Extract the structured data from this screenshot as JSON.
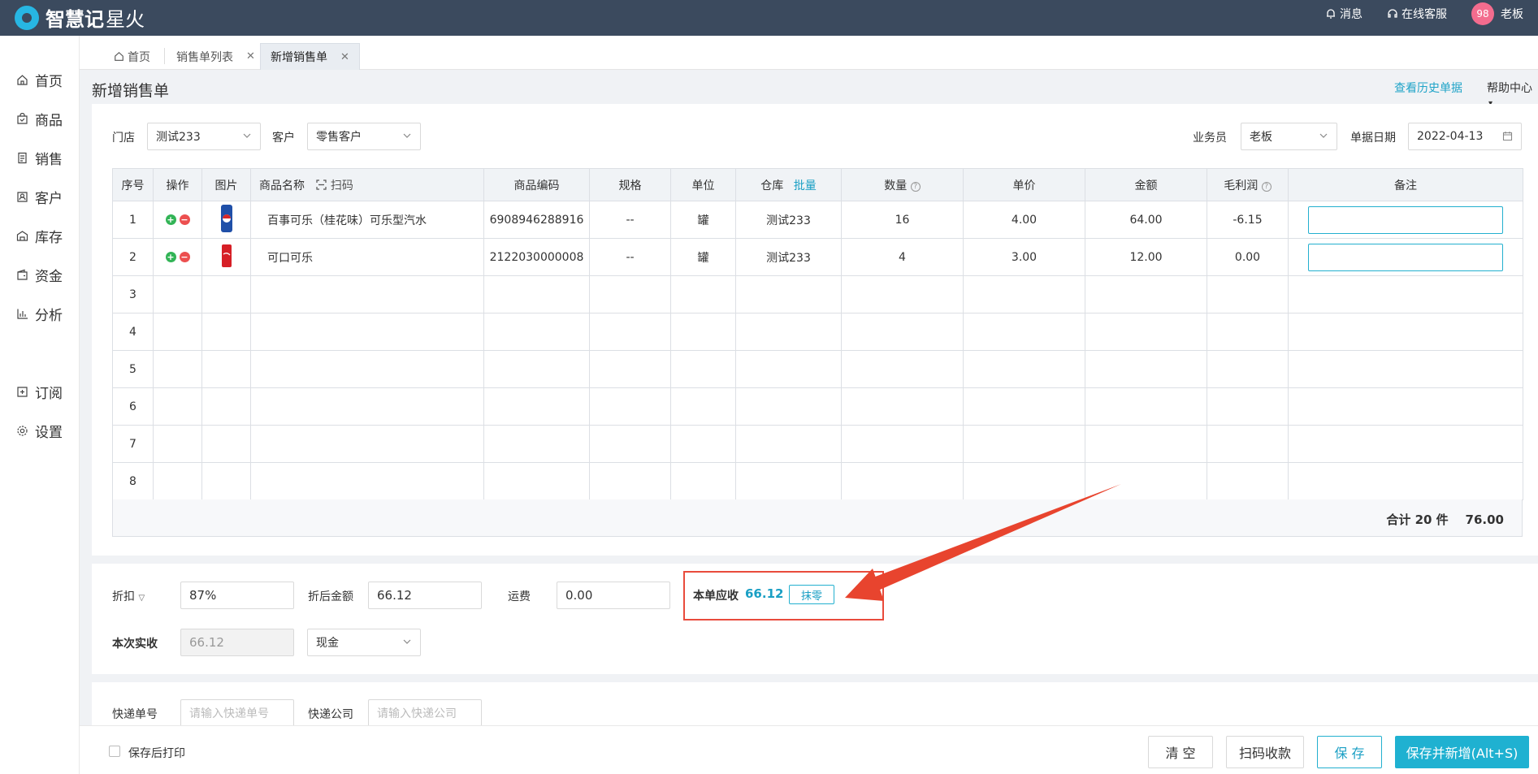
{
  "topbar": {
    "brand": "智慧记",
    "brand_sub": "星火",
    "messages_label": "消息",
    "support_label": "在线客服",
    "avatar_text": "98",
    "user_name": "老板"
  },
  "sidebar": {
    "items": [
      {
        "label": "首页",
        "icon": "home-icon"
      },
      {
        "label": "商品",
        "icon": "bag-icon"
      },
      {
        "label": "销售",
        "icon": "receipt-icon"
      },
      {
        "label": "客户",
        "icon": "contact-icon"
      },
      {
        "label": "库存",
        "icon": "warehouse-icon"
      },
      {
        "label": "资金",
        "icon": "wallet-icon"
      },
      {
        "label": "分析",
        "icon": "chart-icon"
      },
      {
        "label": "订阅",
        "icon": "subscribe-icon"
      },
      {
        "label": "设置",
        "icon": "gear-icon"
      }
    ]
  },
  "tabs": [
    {
      "label": "首页",
      "closable": false,
      "active": false
    },
    {
      "label": "销售单列表",
      "closable": true,
      "active": false
    },
    {
      "label": "新增销售单",
      "closable": true,
      "active": true
    }
  ],
  "page": {
    "title": "新增销售单",
    "history_link": "查看历史单据",
    "help": "帮助中心"
  },
  "form": {
    "store_label": "门店",
    "store_value": "测试233",
    "customer_label": "客户",
    "customer_value": "零售客户",
    "salesperson_label": "业务员",
    "salesperson_value": "老板",
    "date_label": "单据日期",
    "date_value": "2022-04-13"
  },
  "table": {
    "headers": {
      "seq": "序号",
      "ops": "操作",
      "img": "图片",
      "name": "商品名称",
      "scan": "扫码",
      "code": "商品编码",
      "spec": "规格",
      "unit": "单位",
      "warehouse": "仓库",
      "batch": "批量",
      "qty": "数量",
      "price": "单价",
      "amount": "金额",
      "profit": "毛利润",
      "remark": "备注"
    },
    "rows": [
      {
        "seq": "1",
        "name": "百事可乐（桂花味）可乐型汽水",
        "code": "6908946288916",
        "spec": "--",
        "unit": "罐",
        "warehouse": "测试233",
        "qty": "16",
        "price": "4.00",
        "amount": "64.00",
        "profit": "-6.15"
      },
      {
        "seq": "2",
        "name": "可口可乐",
        "code": "2122030000008",
        "spec": "--",
        "unit": "罐",
        "warehouse": "测试233",
        "qty": "4",
        "price": "3.00",
        "amount": "12.00",
        "profit": "0.00"
      },
      {
        "seq": "3"
      },
      {
        "seq": "4"
      },
      {
        "seq": "5"
      },
      {
        "seq": "6"
      },
      {
        "seq": "7"
      },
      {
        "seq": "8"
      }
    ],
    "total": "合计 20 件    76.00"
  },
  "payment": {
    "discount_label": "折扣",
    "discount_value": "87%",
    "after_discount_label": "折后金额",
    "after_discount_value": "66.12",
    "freight_label": "运费",
    "freight_value": "0.00",
    "receivable_label": "本单应收",
    "receivable_value": "66.12",
    "round_button": "抹零",
    "received_label": "本次实收",
    "received_value": "66.12",
    "method_value": "现金"
  },
  "express": {
    "no_label": "快递单号",
    "no_placeholder": "请输入快递单号",
    "company_label": "快递公司",
    "company_placeholder": "请输入快递公司"
  },
  "footer": {
    "print_after_save": "保存后打印",
    "clear": "清 空",
    "scan_pay": "扫码收款",
    "save": "保 存",
    "save_new": "保存并新增(Alt+S)"
  },
  "colors": {
    "topbar": "#3b4a5e",
    "accent": "#1fb1d1",
    "highlight": "#e94b3c"
  }
}
